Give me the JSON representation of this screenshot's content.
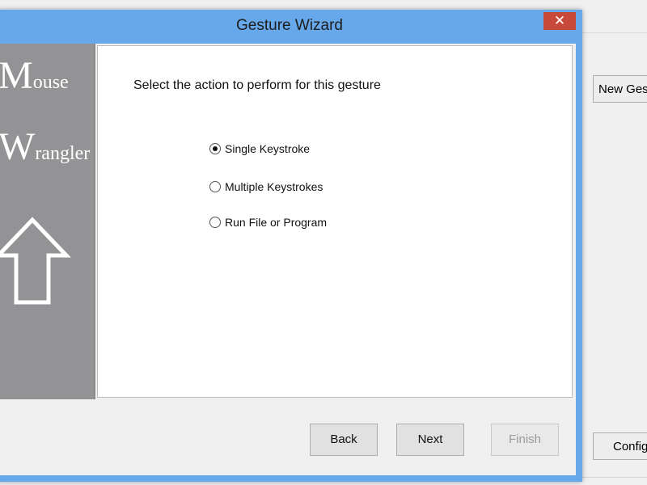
{
  "background_app": {
    "new_button_label": "New Gest",
    "config_button_label": "Config"
  },
  "dialog": {
    "title": "Gesture Wizard",
    "close_symbol": "✕",
    "logo": {
      "line1_cap": "M",
      "line1_rest": "ouse",
      "line2_cap": "W",
      "line2_rest": "rangler",
      "icon": "up-arrow-icon"
    },
    "prompt": "Select the action to perform for this gesture",
    "options": [
      {
        "label": "Single Keystroke",
        "checked": true
      },
      {
        "label": "Multiple Keystrokes",
        "checked": false
      },
      {
        "label": "Run File or Program",
        "checked": false
      }
    ],
    "buttons": {
      "back": "Back",
      "next": "Next",
      "finish": "Finish"
    }
  },
  "colors": {
    "titlebar": "#67a8ea",
    "close": "#c7493a",
    "banner": "#939396"
  }
}
